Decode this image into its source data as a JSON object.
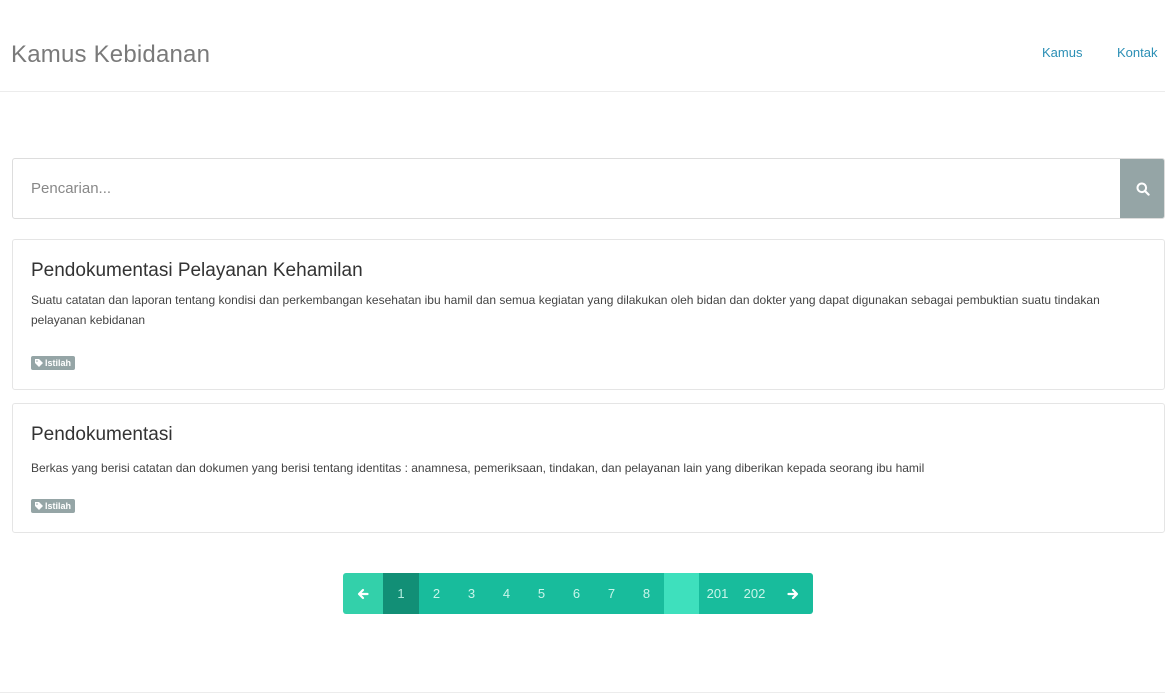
{
  "header": {
    "brand": "Kamus Kebidanan",
    "nav": [
      {
        "label": "Kamus"
      },
      {
        "label": "Kontak"
      }
    ]
  },
  "search": {
    "placeholder": "Pencarian...",
    "value": "",
    "icon": "search-icon"
  },
  "results": [
    {
      "title": "Pendokumentasi Pelayanan Kehamilan",
      "description": "Suatu catatan dan laporan tentang kondisi dan perkembangan kesehatan ibu hamil dan semua kegiatan yang dilakukan oleh bidan dan dokter yang dapat digunakan sebagai pembuktian suatu tindakan pelayanan kebidanan",
      "tag": "Istilah"
    },
    {
      "title": "Pendokumentasi",
      "description": "Berkas yang berisi catatan dan dokumen yang berisi tentang identitas : anamnesa, pemeriksaan, tindakan, dan pelayanan lain yang diberikan kepada seorang ibu hamil",
      "tag": "Istilah"
    }
  ],
  "pagination": {
    "current": 1,
    "pages": [
      "1",
      "2",
      "3",
      "4",
      "5",
      "6",
      "7",
      "8"
    ],
    "ellipsis": "",
    "tail": [
      "201",
      "202"
    ],
    "prev_icon": "arrow-left-icon",
    "next_icon": "arrow-right-icon"
  },
  "colors": {
    "brand_text": "#7a7a7a",
    "link": "#2b8fb5",
    "search_button": "#95a5a6",
    "tag": "#95a5a6",
    "pagination": "#18bc9c",
    "pagination_active": "#128f76"
  }
}
